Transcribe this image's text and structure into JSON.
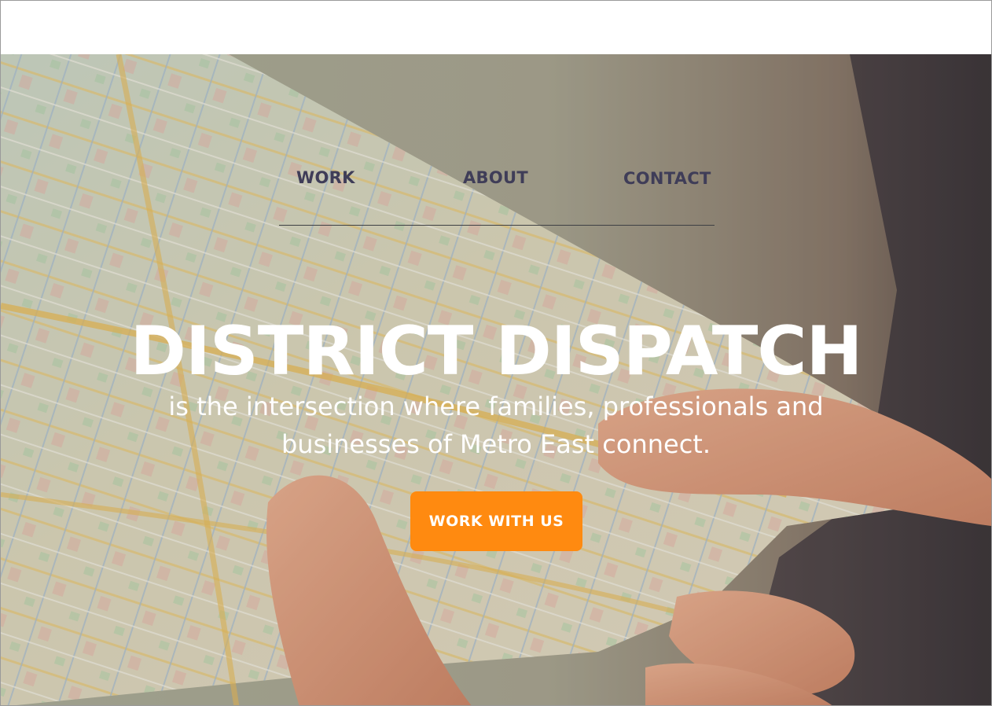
{
  "nav": {
    "items": [
      {
        "label": "WORK"
      },
      {
        "label": "ABOUT"
      },
      {
        "label": "CONTACT"
      }
    ]
  },
  "hero": {
    "title": "DISTRICT DISPATCH",
    "tagline": "is the intersection where families, professionals and businesses of Metro East connect.",
    "cta_label": "WORK WITH US",
    "background_image": "hands-holding-city-map-photo"
  },
  "colors": {
    "nav_text": "#3f3d58",
    "cta_background": "#ff8a10",
    "hero_text": "#ffffff"
  }
}
